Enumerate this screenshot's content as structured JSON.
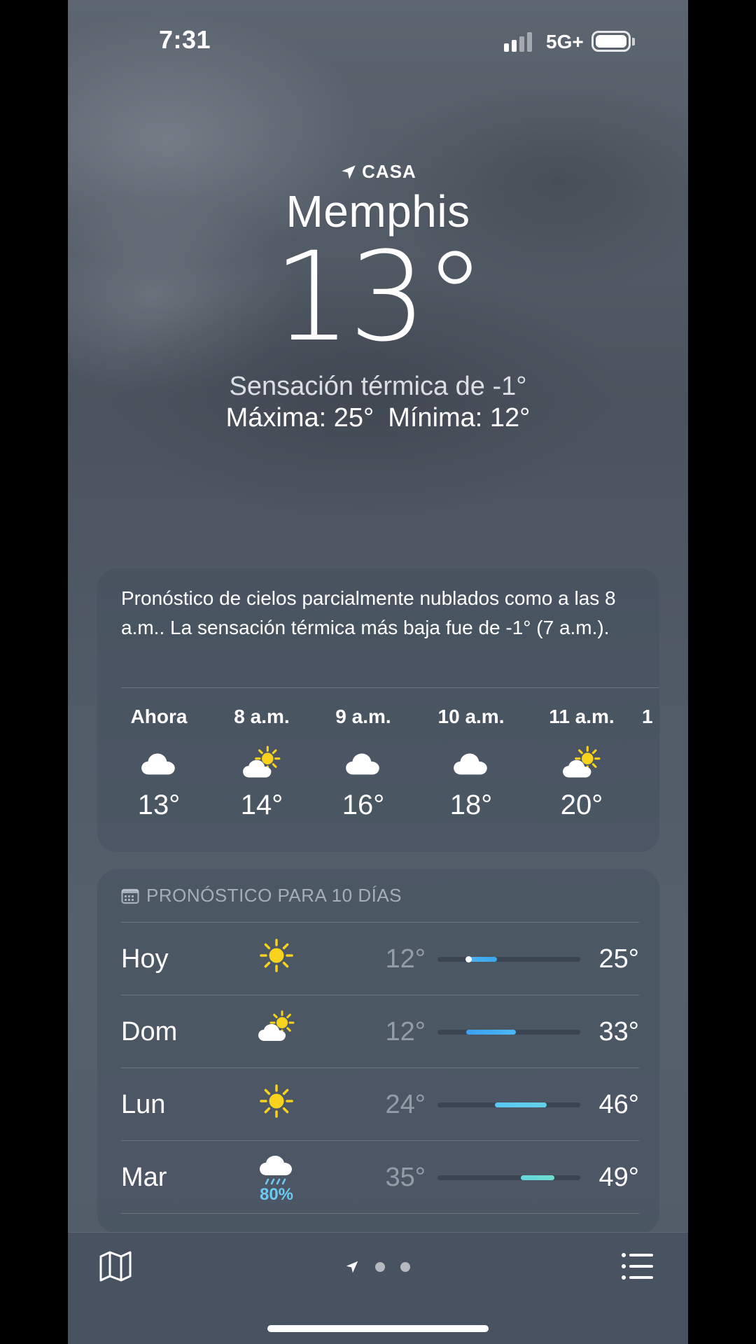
{
  "status_bar": {
    "time": "7:31",
    "network": "5G+"
  },
  "location": {
    "label": "CASA",
    "city": "Memphis"
  },
  "current": {
    "temperature": "13°",
    "feels_like": "Sensación térmica de -1°",
    "high": "Máxima: 25°",
    "low": "Mínima: 12°"
  },
  "hourly": {
    "summary": "Pronóstico de cielos parcialmente nublados como a las 8 a.m.. La sensación térmica más baja fue de -1° (7 a.m.).",
    "items": [
      {
        "label": "Ahora",
        "icon": "cloud-icon",
        "temp": "13°"
      },
      {
        "label": "8 a.m.",
        "icon": "partly-sunny-icon",
        "temp": "14°"
      },
      {
        "label": "9 a.m.",
        "icon": "cloud-icon",
        "temp": "16°"
      },
      {
        "label": "10 a.m.",
        "icon": "cloud-icon",
        "temp": "18°"
      },
      {
        "label": "11 a.m.",
        "icon": "partly-sunny-icon",
        "temp": "20°"
      },
      {
        "label": "1",
        "icon": "",
        "temp": ""
      }
    ]
  },
  "daily": {
    "title": "PRONÓSTICO PARA 10 DÍAS",
    "range_min": 0,
    "range_max": 60,
    "current_temp": 13,
    "items": [
      {
        "day": "Hoy",
        "icon": "sun-icon",
        "precip": "",
        "low": "12°",
        "high": "25°",
        "low_value": 12,
        "high_value": 25,
        "color_from": "#4fb2f0",
        "color_to": "#3aa6ee"
      },
      {
        "day": "Dom",
        "icon": "partly-sunny-icon",
        "precip": "",
        "low": "12°",
        "high": "33°",
        "low_value": 12,
        "high_value": 33,
        "color_from": "#3c9ff0",
        "color_to": "#4db7f2"
      },
      {
        "day": "Lun",
        "icon": "sun-icon",
        "precip": "",
        "low": "24°",
        "high": "46°",
        "low_value": 24,
        "high_value": 46,
        "color_from": "#59c7f0",
        "color_to": "#63d1e8"
      },
      {
        "day": "Mar",
        "icon": "rain-icon",
        "precip": "80%",
        "low": "35°",
        "high": "49°",
        "low_value": 35,
        "high_value": 49,
        "color_from": "#66d6dc",
        "color_to": "#6fdcd0"
      }
    ]
  },
  "bottom_bar": {
    "map_icon": "map-icon",
    "location_icon": "location-arrow-icon",
    "list_icon": "list-icon"
  }
}
